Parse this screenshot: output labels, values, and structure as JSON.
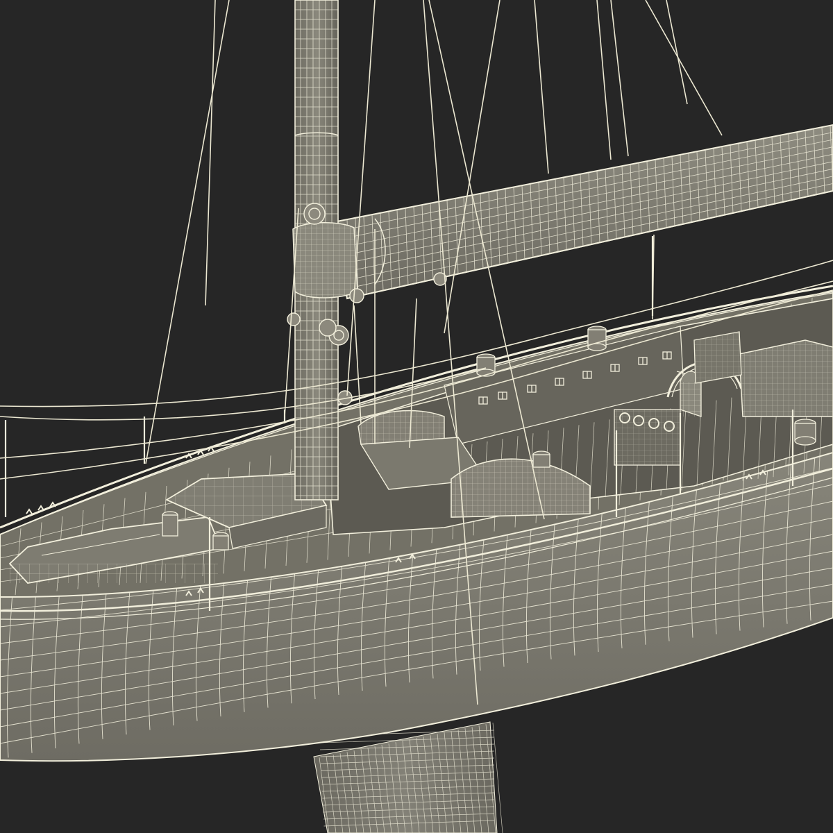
{
  "image": {
    "subject": "sailing-yacht-wireframe-render",
    "palette": {
      "background": "#262626",
      "hull_fill": "#7d7b70",
      "deck_fill": "#6f6d63",
      "interior_fill": "#5c5a52",
      "keel_fill": "#76746a",
      "wire": "#f2efdc",
      "rigging": "#ece8d2"
    }
  }
}
